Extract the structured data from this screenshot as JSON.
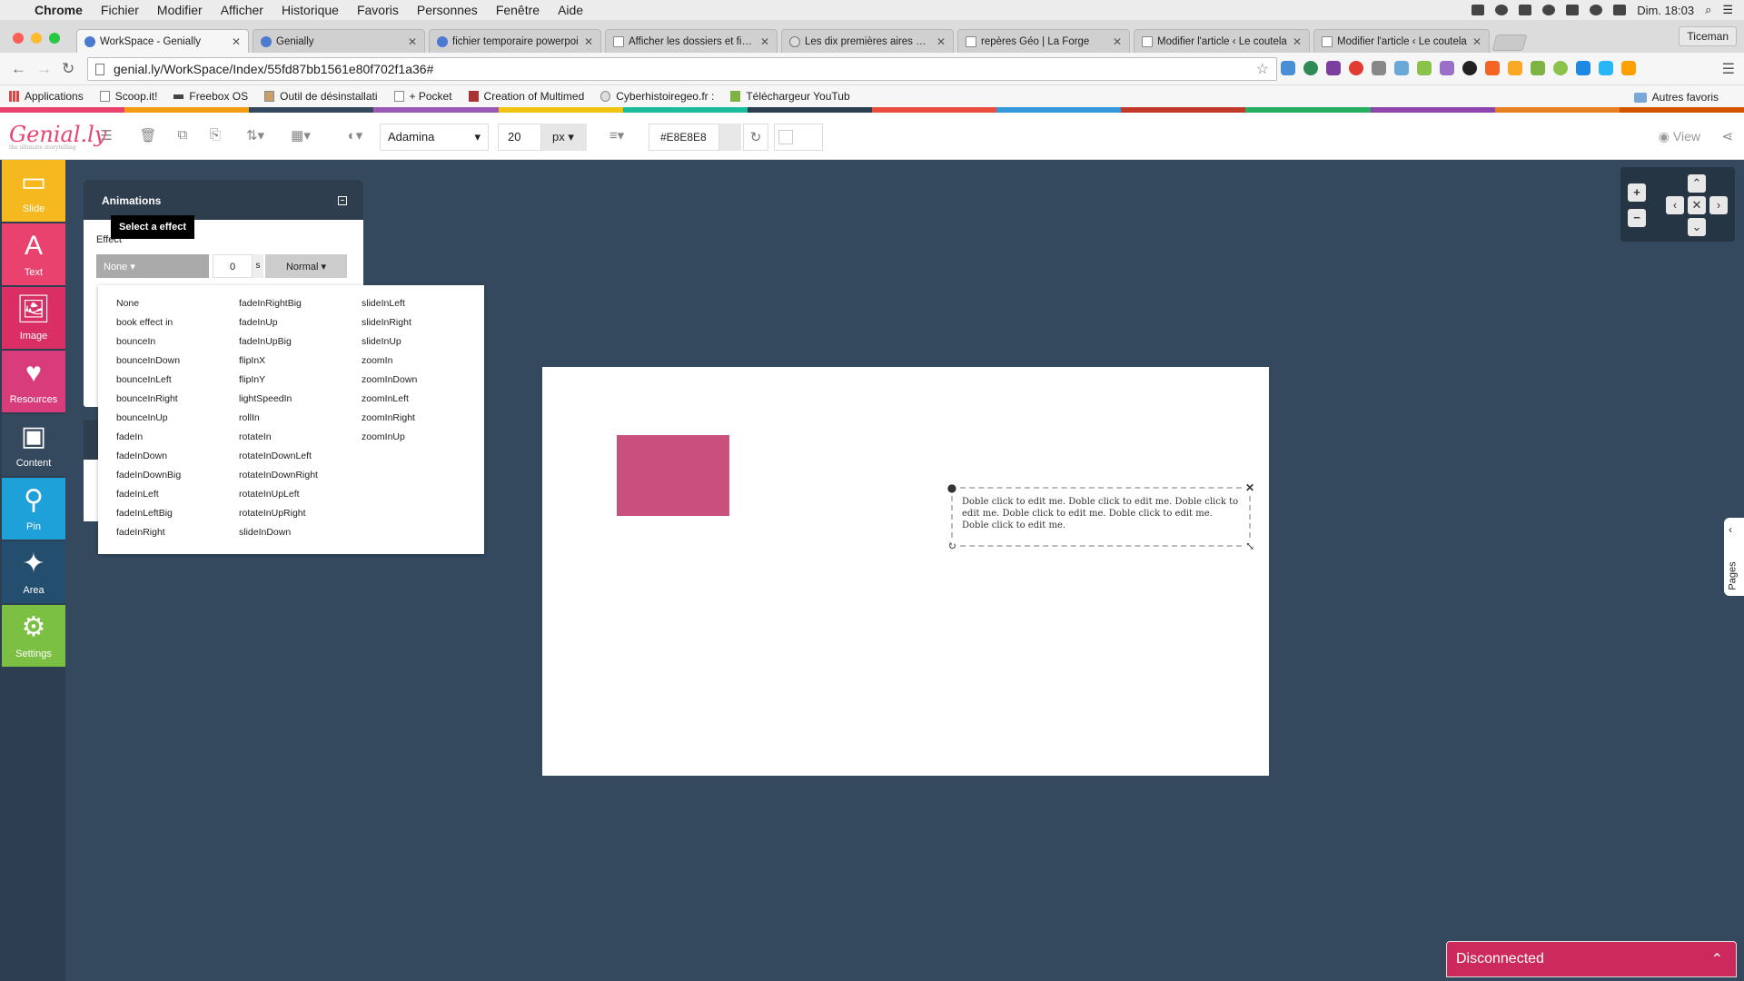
{
  "mac_menu": {
    "apple": "",
    "items": [
      "Chrome",
      "Fichier",
      "Modifier",
      "Afficher",
      "Historique",
      "Favoris",
      "Personnes",
      "Fenêtre",
      "Aide"
    ],
    "clock": "Dim. 18:03"
  },
  "browser": {
    "tabs": [
      {
        "title": "WorkSpace - Genially",
        "active": true
      },
      {
        "title": "Genially"
      },
      {
        "title": "fichier temporaire powerpoi"
      },
      {
        "title": "Afficher les dossiers et fichi"
      },
      {
        "title": "Les dix premières aires urba"
      },
      {
        "title": "repères Géo | La Forge"
      },
      {
        "title": "Modifier l'article ‹ Le coutela"
      },
      {
        "title": "Modifier l'article ‹ Le coutela"
      }
    ],
    "profile": "Ticeman",
    "url": "genial.ly/WorkSpace/Index/55fd87bb1561e80f702f1a36#",
    "bookmarks": [
      "Applications",
      "Scoop.it!",
      "Freebox OS",
      "Outil de désinstallati",
      "+ Pocket",
      "Creation of Multimed",
      "Cyberhistoiregeo.fr :",
      "Téléchargeur YouTub"
    ],
    "other_bookmarks": "Autres favoris"
  },
  "stripe_colors": [
    "#e9426f",
    "#f39c12",
    "#34495e",
    "#9b59b6",
    "#f1c40f",
    "#1abc9c",
    "#2c3e50",
    "#e74c3c",
    "#3498db",
    "#c0392b",
    "#27ae60",
    "#8e44ad",
    "#e67e22",
    "#d35400"
  ],
  "toolbar": {
    "logo": "Genial.ly",
    "logo_tagline": "the ultimate storytelling",
    "font": "Adamina",
    "font_size": "20",
    "unit": "px",
    "color_value": "#E8E8E8",
    "view_label": "View"
  },
  "sidebar": [
    {
      "label": "Slide",
      "icon": "slide-icon",
      "glyph": "▭",
      "color": "#f6b81f"
    },
    {
      "label": "Text",
      "icon": "text-icon",
      "glyph": "A",
      "color": "#e9426f"
    },
    {
      "label": "Image",
      "icon": "image-icon",
      "glyph": "🖼",
      "color": "#d92f64"
    },
    {
      "label": "Resources",
      "icon": "heart-icon",
      "glyph": "♥",
      "color": "#d83c7b"
    },
    {
      "label": "Content",
      "icon": "monitor-icon",
      "glyph": "▣",
      "color": "#34495e"
    },
    {
      "label": "Pin",
      "icon": "pin-icon",
      "glyph": "⚲",
      "color": "#1ea0d8"
    },
    {
      "label": "Area",
      "icon": "magic-wand-icon",
      "glyph": "✦",
      "color": "#244e6d"
    },
    {
      "label": "Settings",
      "icon": "gear-icon",
      "glyph": "⚙",
      "color": "#7bc043"
    }
  ],
  "animations": {
    "title": "Animations",
    "effect_label": "Effect",
    "tooltip": "Select a effect",
    "selected_effect": "None",
    "delay": "0",
    "delay_unit": "s",
    "speed": "Normal",
    "effects_col1": [
      "None",
      "book effect in",
      "bounceIn",
      "bounceInDown",
      "bounceInLeft",
      "bounceInRight",
      "bounceInUp",
      "fadeIn",
      "fadeInDown",
      "fadeInDownBig",
      "fadeInLeft",
      "fadeInLeftBig",
      "fadeInRight"
    ],
    "effects_col2": [
      "fadeInRightBig",
      "fadeInUp",
      "fadeInUpBig",
      "flipInX",
      "flipInY",
      "lightSpeedIn",
      "rollIn",
      "rotateIn",
      "rotateInDownLeft",
      "rotateInDownRight",
      "rotateInUpLeft",
      "rotateInUpRight",
      "slideInDown"
    ],
    "effects_col3": [
      "slideInLeft",
      "slideInRight",
      "slideInUp",
      "zoomIn",
      "zoomInDown",
      "zoomInLeft",
      "zoomInRight",
      "zoomInUp"
    ]
  },
  "slide": {
    "text_box": "Doble click to edit me. Doble click to edit me. Doble click to edit me. Doble click to edit me. Doble click to edit me. Doble click to edit me.",
    "rect_color": "#c94f7c"
  },
  "pages_label": "Pages",
  "status": "Disconnected"
}
